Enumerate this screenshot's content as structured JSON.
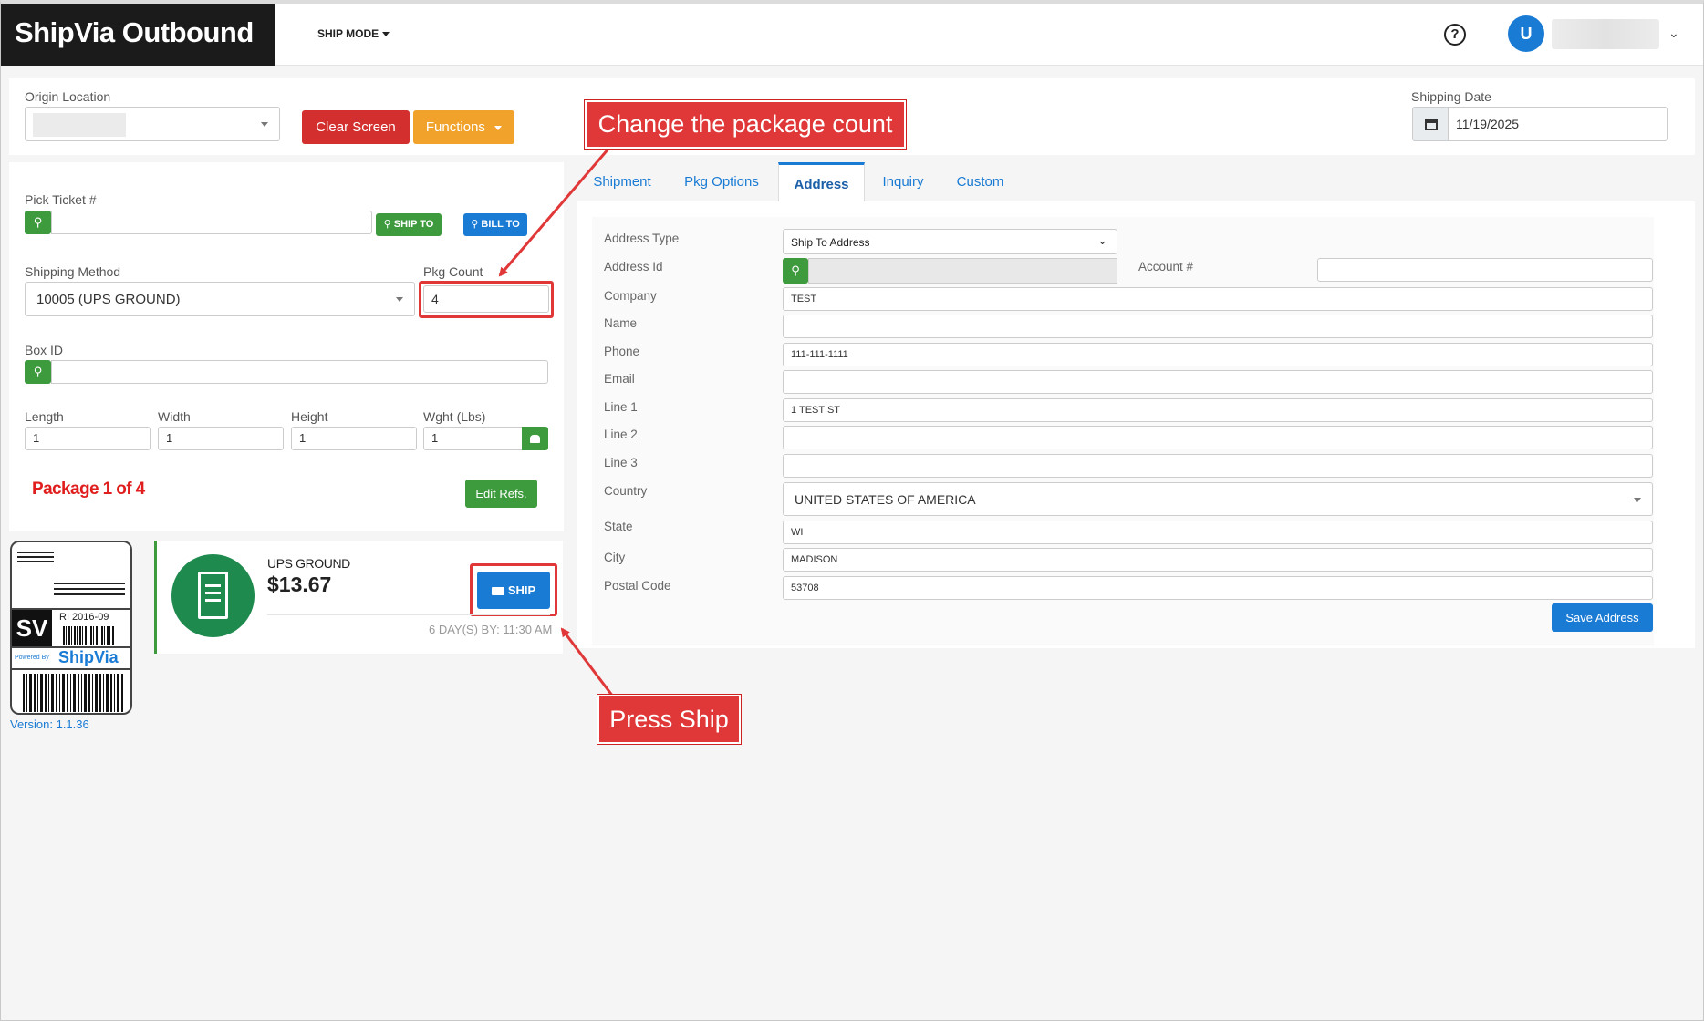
{
  "header": {
    "brand": "ShipVia Outbound",
    "ship_mode": "SHIP MODE",
    "help_icon": "?",
    "user_initial": "U"
  },
  "top": {
    "origin_label": "Origin Location",
    "clear_screen": "Clear Screen",
    "functions": "Functions",
    "shipping_date_label": "Shipping Date",
    "shipping_date": "11/19/2025"
  },
  "left": {
    "pick_ticket_label": "Pick Ticket #",
    "ship_to": "SHIP TO",
    "bill_to": "BILL TO",
    "shipping_method_label": "Shipping Method",
    "shipping_method": "10005 (UPS GROUND)",
    "pkg_count_label": "Pkg Count",
    "pkg_count": "4",
    "box_id_label": "Box ID",
    "length_label": "Length",
    "width_label": "Width",
    "height_label": "Height",
    "weight_label": "Wght (Lbs)",
    "length": "1",
    "width": "1",
    "height": "1",
    "weight": "1",
    "package_status": "Package 1 of 4",
    "edit_refs": "Edit Refs."
  },
  "rate": {
    "service": "UPS GROUND",
    "price": "$13.67",
    "ship": "SHIP",
    "eta": "6 DAY(S) BY: 11:30 AM"
  },
  "logo": {
    "code": "SV",
    "revision": "RI 2016-09",
    "powered_by": "Powered By",
    "brand": "ShipVia"
  },
  "version": "Version: 1.1.36",
  "tabs": [
    {
      "label": "Shipment"
    },
    {
      "label": "Pkg Options"
    },
    {
      "label": "Address"
    },
    {
      "label": "Inquiry"
    },
    {
      "label": "Custom"
    }
  ],
  "address": {
    "type_label": "Address Type",
    "type_value": "Ship To Address",
    "id_label": "Address Id",
    "account_label": "Account #",
    "company_label": "Company",
    "company": "TEST",
    "name_label": "Name",
    "phone_label": "Phone",
    "phone": "111-111-1111",
    "email_label": "Email",
    "line1_label": "Line 1",
    "line1": "1 TEST ST",
    "line2_label": "Line 2",
    "line3_label": "Line 3",
    "country_label": "Country",
    "country": "UNITED STATES OF AMERICA",
    "state_label": "State",
    "state": "WI",
    "city_label": "City",
    "city": "MADISON",
    "postal_label": "Postal Code",
    "postal": "53708",
    "save": "Save Address"
  },
  "annotations": {
    "pkg_callout": "Change the package count",
    "ship_callout": "Press Ship"
  },
  "colors": {
    "brand_dark": "#1b1b1b",
    "primary_blue": "#1a7bd4",
    "danger_red": "#d32f2f",
    "warning_orange": "#f0a22a",
    "success_green": "#3d9a3d",
    "rate_green": "#1e8a4e",
    "callout_red": "#e03838"
  }
}
